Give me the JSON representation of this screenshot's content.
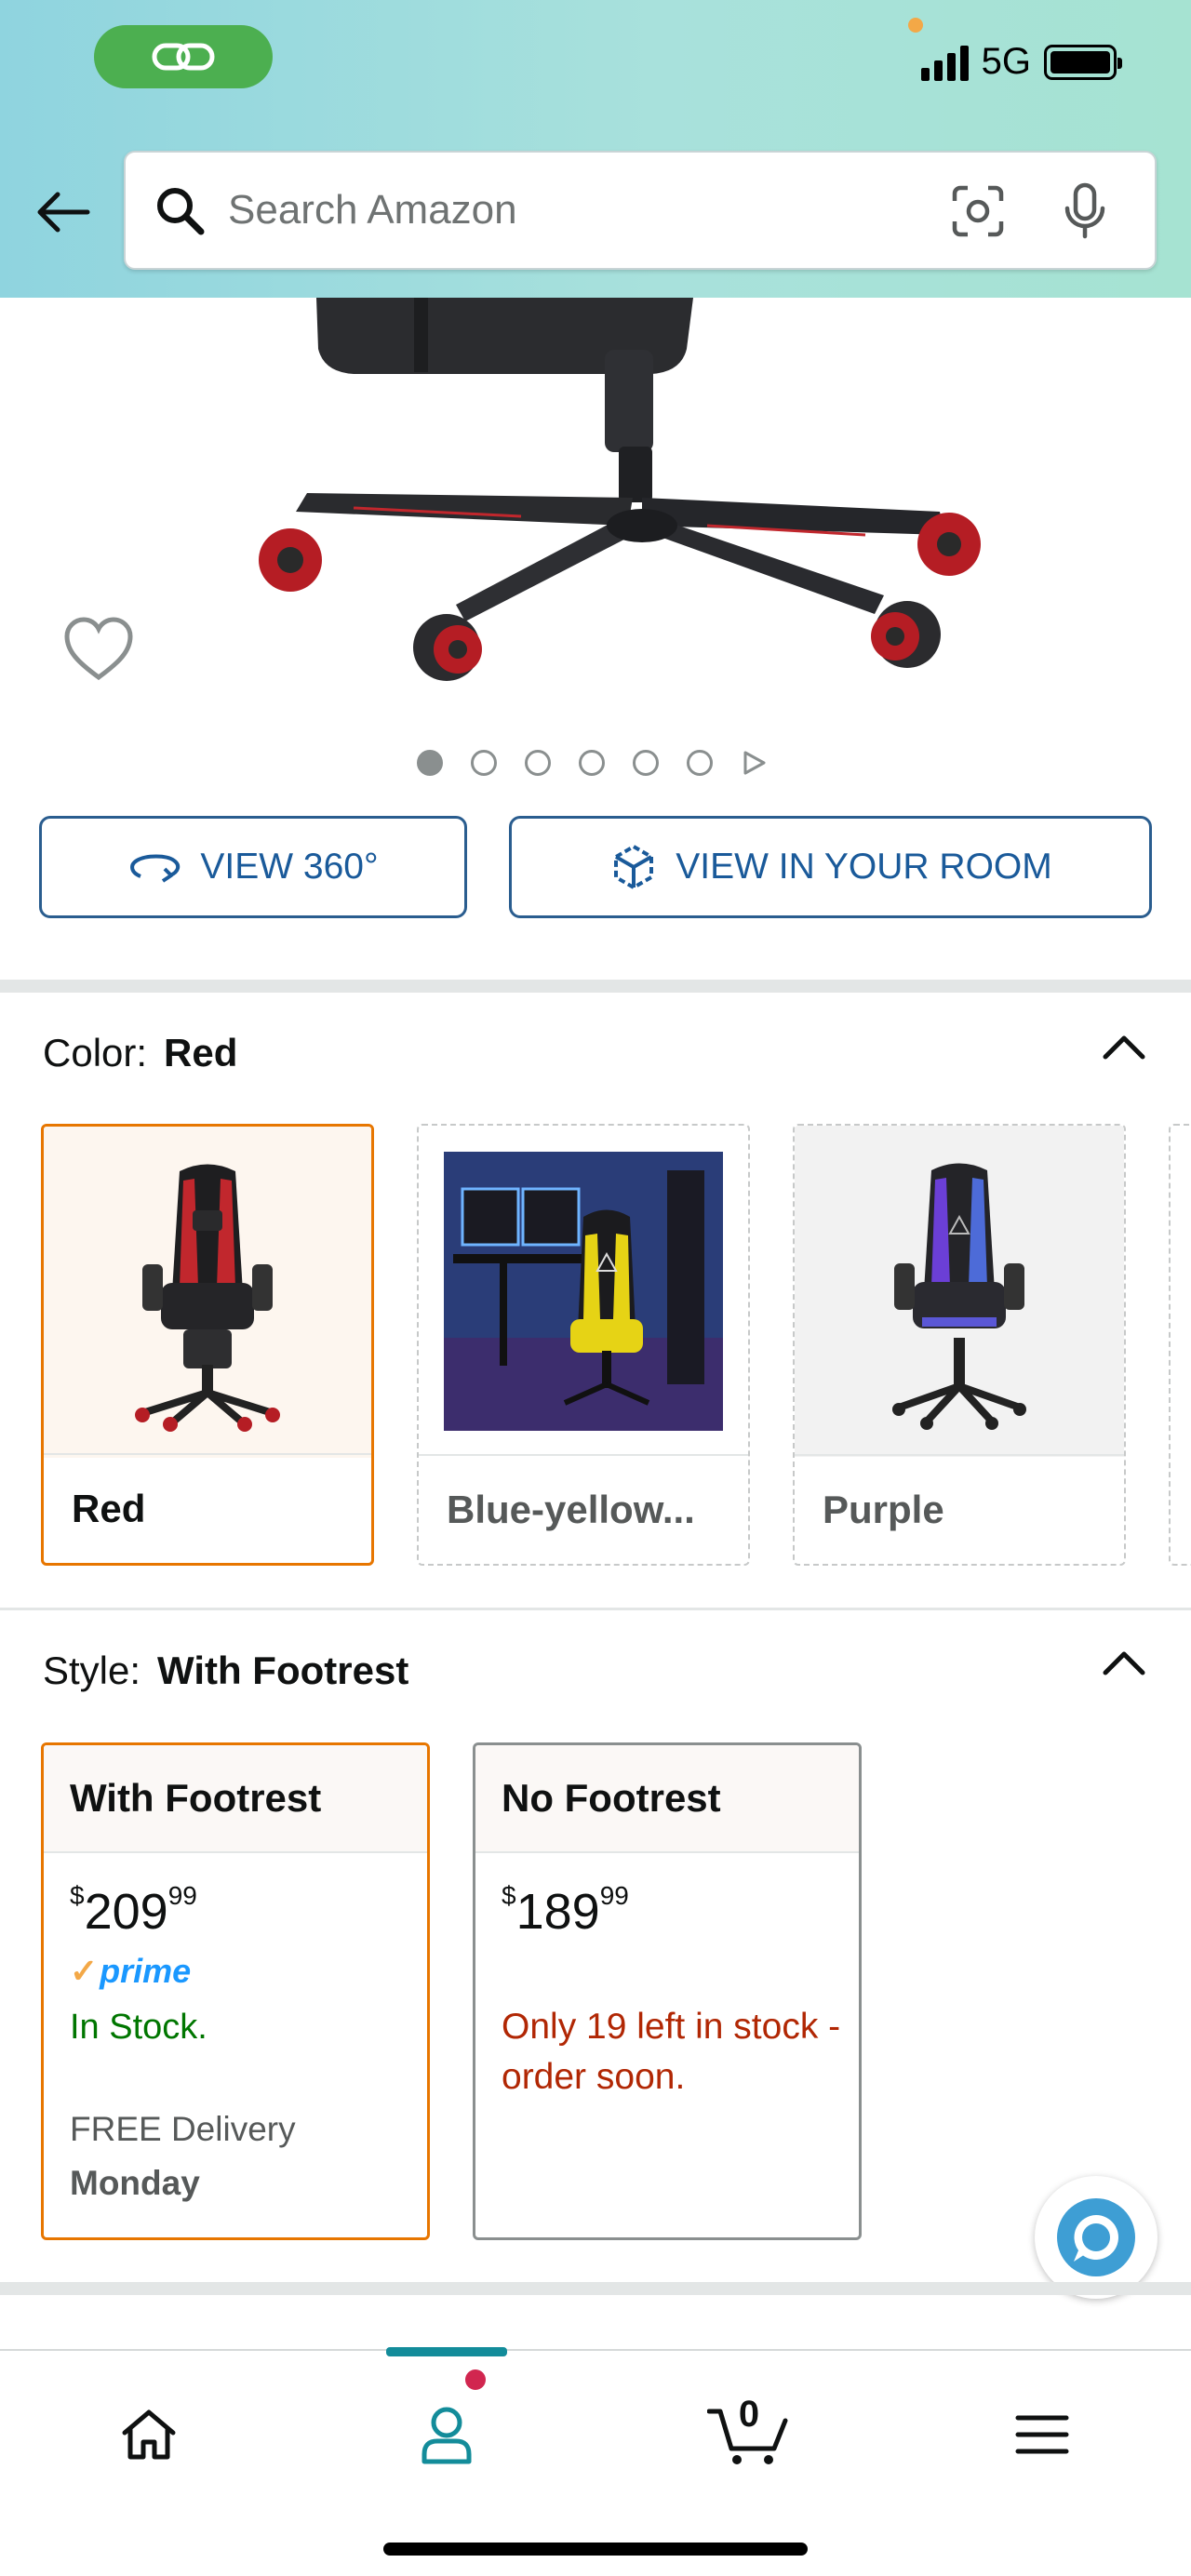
{
  "status_bar": {
    "network": "5G"
  },
  "search": {
    "placeholder": "Search Amazon"
  },
  "carousel": {
    "image_count": 6,
    "active_index": 0
  },
  "actions": {
    "view_360": "VIEW 360°",
    "view_in_room": "VIEW IN YOUR ROOM"
  },
  "color": {
    "label": "Color:",
    "selected": "Red",
    "options": [
      {
        "label": "Red"
      },
      {
        "label": "Blue-yellow..."
      },
      {
        "label": "Purple"
      }
    ]
  },
  "style": {
    "label": "Style:",
    "selected": "With Footrest",
    "options": [
      {
        "title": "With Footrest",
        "price_symbol": "$",
        "price_whole": "209",
        "price_fraction": "99",
        "prime": "prime",
        "stock": "In Stock.",
        "delivery": "FREE Delivery",
        "delivery_day": "Monday"
      },
      {
        "title": "No Footrest",
        "price_symbol": "$",
        "price_whole": "189",
        "price_fraction": "99",
        "stock_warning": "Only 19 left in stock - order soon."
      }
    ]
  },
  "bottom_nav": {
    "cart_count": "0"
  },
  "colors": {
    "header_start": "#8fd4df",
    "header_end": "#a6e3d2",
    "selected_border": "#e77600",
    "link_blue": "#1a5a9a",
    "in_stock_green": "#007600",
    "low_stock_red": "#b12704",
    "nav_active": "#138c9a"
  }
}
